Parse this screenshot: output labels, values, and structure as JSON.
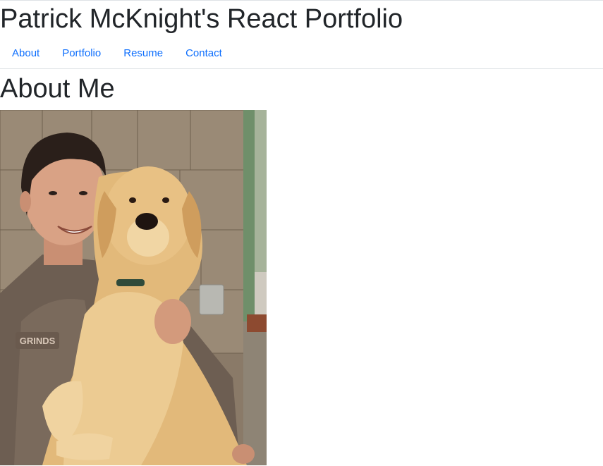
{
  "header": {
    "title": "Patrick McKnight's React Portfolio"
  },
  "nav": {
    "items": [
      {
        "label": "About"
      },
      {
        "label": "Portfolio"
      },
      {
        "label": "Resume"
      },
      {
        "label": "Contact"
      }
    ]
  },
  "about": {
    "heading": "About Me",
    "photo_text": "GRINDS"
  },
  "colors": {
    "link": "#0d6efd",
    "text": "#212529",
    "divider": "#dee2e6"
  }
}
